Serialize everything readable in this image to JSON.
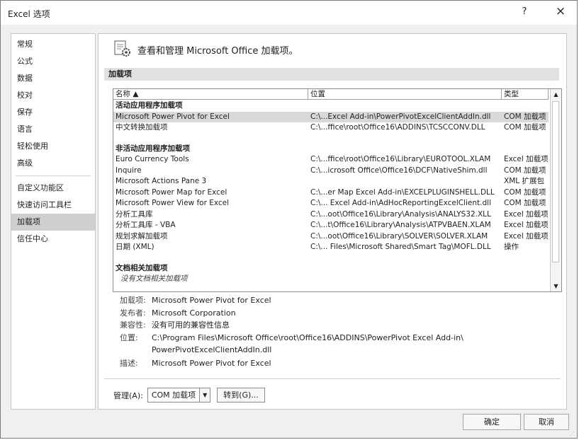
{
  "window": {
    "title": "Excel 选项",
    "help_label": "?",
    "close_label": "×"
  },
  "nav": {
    "items_top": [
      {
        "label": "常规"
      },
      {
        "label": "公式"
      },
      {
        "label": "数据"
      },
      {
        "label": "校对"
      },
      {
        "label": "保存"
      },
      {
        "label": "语言"
      },
      {
        "label": "轻松使用"
      },
      {
        "label": "高级"
      }
    ],
    "items_bottom": [
      {
        "label": "自定义功能区"
      },
      {
        "label": "快速访问工具栏"
      },
      {
        "label": "加载项",
        "selected": true
      },
      {
        "label": "信任中心"
      }
    ]
  },
  "main": {
    "header": "查看和管理 Microsoft Office 加载项。",
    "header_icon": "addins-gear-icon",
    "section_title": "加载项",
    "columns": {
      "name": "名称 ▲",
      "location": "位置",
      "type": "类型"
    },
    "groups": {
      "active": {
        "title": "活动应用程序加载项",
        "rows": [
          {
            "name": "Microsoft Power Pivot for Excel",
            "location": "C:\\...Excel Add-in\\PowerPivotExcelClientAddIn.dll",
            "type": "COM 加载项"
          },
          {
            "name": "中文转换加载项",
            "location": "C:\\...ffice\\root\\Office16\\ADDINS\\TCSCCONV.DLL",
            "type": "COM 加载项"
          }
        ]
      },
      "inactive": {
        "title": "非活动应用程序加载项",
        "rows": [
          {
            "name": "Euro Currency Tools",
            "location": "C:\\...ffice\\root\\Office16\\Library\\EUROTOOL.XLAM",
            "type": "Excel 加载项"
          },
          {
            "name": "Inquire",
            "location": "C:\\...icrosoft Office\\Office16\\DCF\\NativeShim.dll",
            "type": "COM 加载项"
          },
          {
            "name": "Microsoft Actions Pane 3",
            "location": "",
            "type": "XML 扩展包"
          },
          {
            "name": "Microsoft Power Map for Excel",
            "location": "C:\\...er Map Excel Add-in\\EXCELPLUGINSHELL.DLL",
            "type": "COM 加载项"
          },
          {
            "name": "Microsoft Power View for Excel",
            "location": "C:\\... Excel Add-in\\AdHocReportingExcelClient.dll",
            "type": "COM 加载项"
          },
          {
            "name": "分析工具库",
            "location": "C:\\...oot\\Office16\\Library\\Analysis\\ANALYS32.XLL",
            "type": "Excel 加载项"
          },
          {
            "name": "分析工具库 - VBA",
            "location": "C:\\...t\\Office16\\Library\\Analysis\\ATPVBAEN.XLAM",
            "type": "Excel 加载项"
          },
          {
            "name": "规划求解加载项",
            "location": "C:\\...oot\\Office16\\Library\\SOLVER\\SOLVER.XLAM",
            "type": "Excel 加载项"
          },
          {
            "name": "日期 (XML)",
            "location": "C:\\... Files\\Microsoft Shared\\Smart Tag\\MOFL.DLL",
            "type": "操作"
          }
        ]
      },
      "document": {
        "title": "文档相关加载项",
        "empty_note": "没有文档相关加载项"
      }
    },
    "details": {
      "addin_label": "加载项:",
      "addin": "Microsoft Power Pivot for Excel",
      "publisher_label": "发布者:",
      "publisher": "Microsoft Corporation",
      "compat_label": "兼容性:",
      "compat": "没有可用的兼容性信息",
      "location_label": "位置:",
      "location_line1": "C:\\Program Files\\Microsoft Office\\root\\Office16\\ADDINS\\PowerPivot Excel Add-in\\",
      "location_line2": "PowerPivotExcelClientAddIn.dll",
      "desc_label": "描述:",
      "desc": "Microsoft Power Pivot for Excel"
    },
    "manage": {
      "label": "管理(A):",
      "value": "COM 加载项",
      "go_label": "转到(G)..."
    }
  },
  "footer": {
    "ok": "确定",
    "cancel": "取消"
  }
}
